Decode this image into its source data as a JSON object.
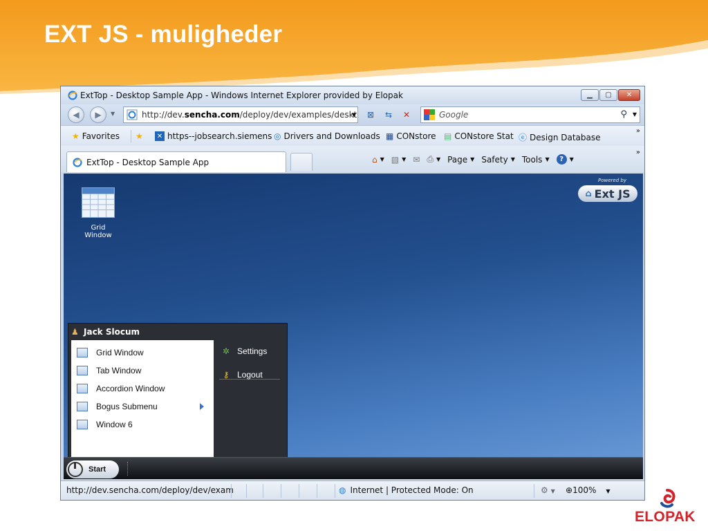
{
  "slide": {
    "title": "EXT JS - muligheder",
    "logo_text": "ELOPAK",
    "colors": {
      "banner": "#f5a623",
      "logo_red": "#d2232a"
    }
  },
  "browser": {
    "window_title": "ExtTop - Desktop Sample App - Windows Internet Explorer provided by Elopak",
    "address_prefix": "http://dev.",
    "address_domain": "sencha.com",
    "address_path": "/deploy/dev/examples/deskt",
    "search_placeholder": "Google",
    "favorites": [
      {
        "label": "Favorites",
        "icon": "star-icon"
      },
      {
        "label": "https--jobsearch.siemens",
        "icon": "siemens-icon"
      },
      {
        "label": "Drivers and Downloads",
        "icon": "dell-icon"
      },
      {
        "label": "CONstore",
        "icon": "constore-icon"
      },
      {
        "label": "CONstore Stat",
        "icon": "page-icon"
      },
      {
        "label": "Design Database",
        "icon": "ie-icon"
      }
    ],
    "tab_label": "ExtTop - Desktop Sample App",
    "commands": {
      "page": "Page",
      "safety": "Safety",
      "tools": "Tools"
    },
    "status_url": "http://dev.sencha.com/deploy/dev/exam",
    "status_zone": "Internet | Protected Mode: On",
    "zoom": "100%"
  },
  "desktop": {
    "shortcut_label": "Grid Window",
    "powered_by": "Powered by",
    "extjs_label": "Ext JS",
    "start_menu": {
      "user": "Jack Slocum",
      "items": [
        {
          "label": "Grid Window"
        },
        {
          "label": "Tab Window"
        },
        {
          "label": "Accordion Window"
        },
        {
          "label": "Bogus Submenu"
        },
        {
          "label": "Window 6"
        }
      ],
      "tools": [
        {
          "label": "Settings"
        },
        {
          "label": "Logout"
        }
      ]
    },
    "start_label": "Start"
  }
}
